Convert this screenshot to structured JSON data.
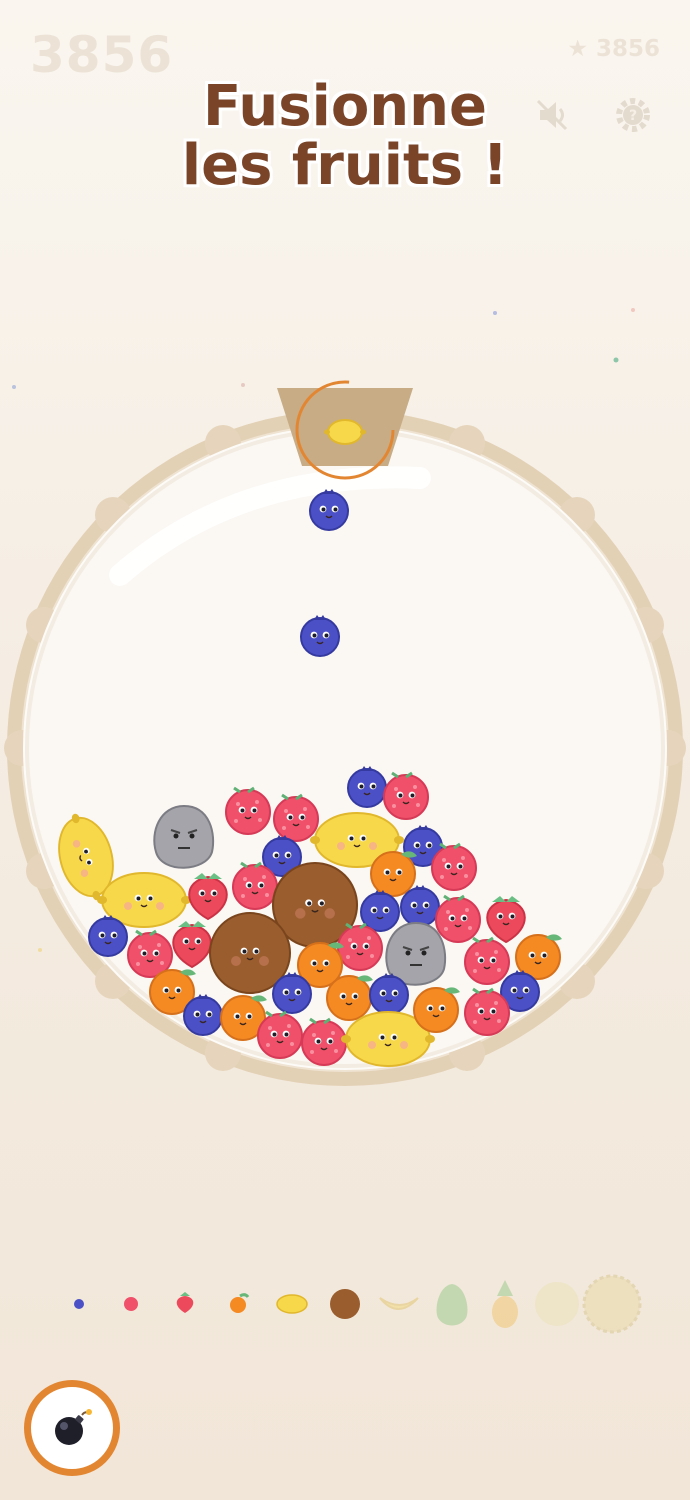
{
  "hud": {
    "score": "3856",
    "best_score": "★ 3856"
  },
  "title": {
    "line1": "Fusionne",
    "line2": "les fruits !"
  },
  "controls": {
    "sound_icon": "speaker-muted-icon",
    "help_icon": "help-gear-icon",
    "bomb_icon": "bomb-icon"
  },
  "next_fruit": "lemon",
  "dropping_fruits": [
    "blueberry",
    "blueberry"
  ],
  "evolution_chain": [
    "blueberry",
    "raspberry",
    "strawberry",
    "orange",
    "lemon",
    "kiwi",
    "banana",
    "avocado",
    "pineapple",
    "melon",
    "durian"
  ],
  "colors": {
    "accent": "#e38632",
    "title": "#7a4428",
    "rim": "#e1cdb1"
  }
}
